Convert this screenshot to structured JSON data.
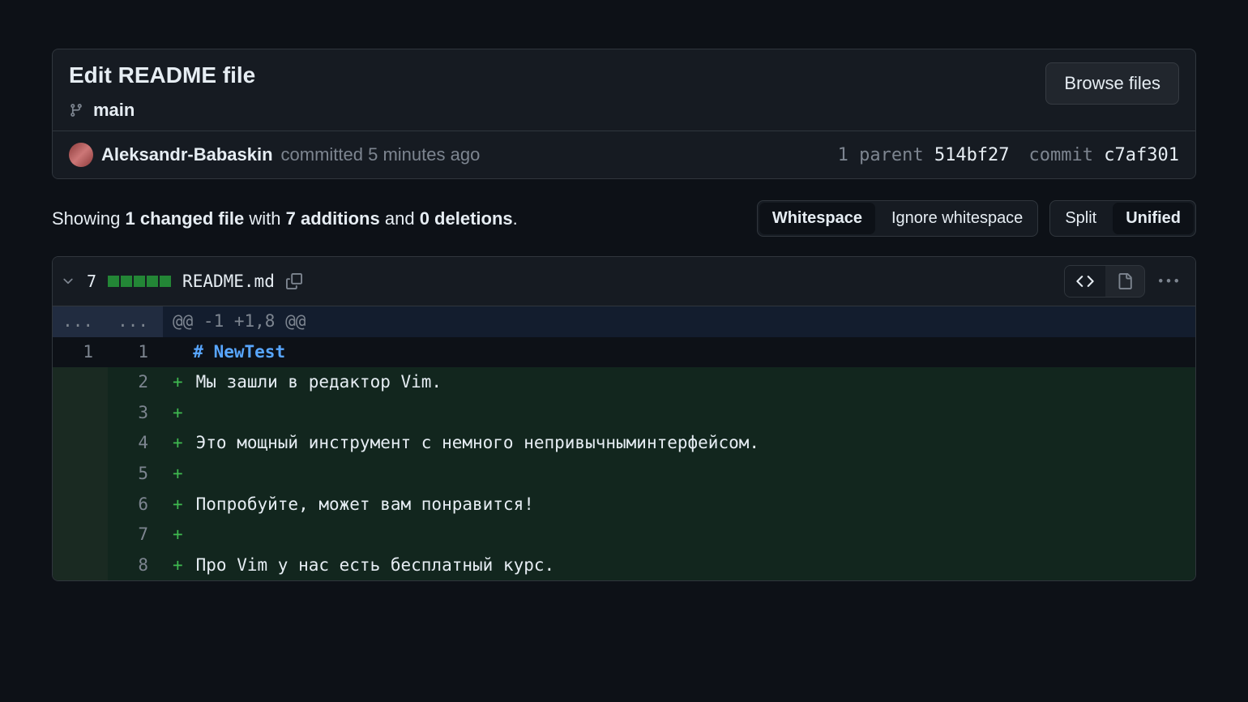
{
  "commit": {
    "title": "Edit README file",
    "browse_label": "Browse files",
    "branch": "main",
    "author": "Aleksandr-Babaskin",
    "committed_text": "committed 5 minutes ago",
    "parent_label": "1 parent",
    "parent_hash": "514bf27",
    "commit_label": "commit",
    "commit_hash": "c7af301"
  },
  "summary": {
    "showing": "Showing",
    "changed_files": "1 changed file",
    "with": "with",
    "additions": "7 additions",
    "and": "and",
    "deletions": "0 deletions",
    "period": "."
  },
  "whitespace_toggle": {
    "show": "Whitespace",
    "ignore": "Ignore whitespace"
  },
  "view_toggle": {
    "split": "Split",
    "unified": "Unified"
  },
  "file": {
    "changes": "7",
    "name": "README.md",
    "add_squares": 5,
    "hunk_header": "@@ -1 +1,8 @@",
    "lines": [
      {
        "type": "context",
        "old": "1",
        "new": "1",
        "marker": "",
        "text_html": "<span class='md-head'># NewTest</span>"
      },
      {
        "type": "addition",
        "old": "",
        "new": "2",
        "marker": "+",
        "text_html": "Мы зашли в редактор Vim."
      },
      {
        "type": "addition",
        "old": "",
        "new": "3",
        "marker": "+",
        "text_html": ""
      },
      {
        "type": "addition",
        "old": "",
        "new": "4",
        "marker": "+",
        "text_html": "Это мощный инструмент с немного непривычныминтерфейсом."
      },
      {
        "type": "addition",
        "old": "",
        "new": "5",
        "marker": "+",
        "text_html": ""
      },
      {
        "type": "addition",
        "old": "",
        "new": "6",
        "marker": "+",
        "text_html": "Попробуйте, может вам понравится!"
      },
      {
        "type": "addition",
        "old": "",
        "new": "7",
        "marker": "+",
        "text_html": ""
      },
      {
        "type": "addition",
        "old": "",
        "new": "8",
        "marker": "+",
        "text_html": "Про Vim у нас есть бесплатный курс."
      }
    ]
  },
  "ellipsis": "..."
}
